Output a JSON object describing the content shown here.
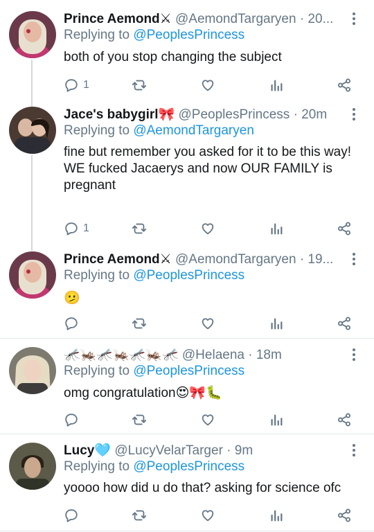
{
  "tweets": [
    {
      "name": "Prince Aemond",
      "name_emoji": "⚔",
      "handle": "@AemondTargaryen",
      "time": "· 20...",
      "replying_prefix": "Replying to",
      "replying_to": "@PeoplesPrincess",
      "text": "both of you stop changing the subject",
      "reply_count": "1"
    },
    {
      "name": "Jace's babygirl",
      "name_emoji": "🎀",
      "handle": "@PeoplesPrincess",
      "time": "· 20m",
      "replying_prefix": "Replying to",
      "replying_to": "@AemondTargaryen",
      "text": "fine but remember you asked for it to be this way!\nWE fucked Jacaerys and now OUR FAMILY is pregnant",
      "reply_count": "1"
    },
    {
      "name": "Prince Aemond",
      "name_emoji": "⚔",
      "handle": "@AemondTargaryen",
      "time": "· 19...",
      "replying_prefix": "Replying to",
      "replying_to": "@PeoplesPrincess",
      "text": "🫤",
      "reply_count": ""
    },
    {
      "name": "🦟🦗🦟🦗🦟🦗🦟",
      "name_emoji": "",
      "handle": "@Helaena",
      "time": "· 18m",
      "replying_prefix": "Replying to",
      "replying_to": "@PeoplesPrincess",
      "text": "omg congratulation😍🎀🐛",
      "reply_count": ""
    },
    {
      "name": "Lucy",
      "name_emoji": "🩵",
      "handle": "@LucyVelarTarger",
      "time": "· 9m",
      "replying_prefix": "Replying to",
      "replying_to": "@PeoplesPrincess",
      "text": "yoooo how did u do that? asking for science ofc",
      "reply_count": ""
    }
  ],
  "icons": {
    "reply": "reply-icon",
    "retweet": "retweet-icon",
    "like": "heart-icon",
    "analytics": "analytics-icon",
    "share": "share-icon",
    "more": "more-vertical-icon"
  },
  "colors": {
    "text": "#14171a",
    "secondary": "#657786",
    "link": "#1b95e0",
    "separator": "#e1e8ed",
    "thread_line": "#cfd9de"
  }
}
